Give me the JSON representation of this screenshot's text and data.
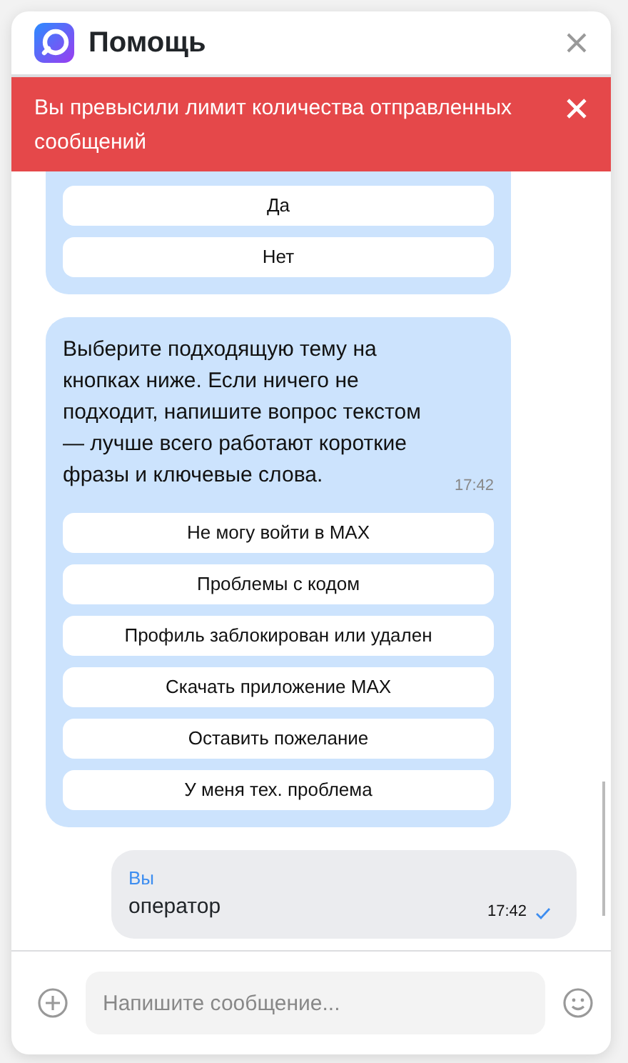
{
  "header": {
    "title": "Помощь"
  },
  "alert": {
    "text": "Вы превысили лимит количества отправленных сообщений"
  },
  "messages": [
    {
      "kind": "bot",
      "cut": true,
      "buttons": [
        "Да",
        "Нет"
      ]
    },
    {
      "kind": "bot",
      "cut": false,
      "text": "Выберите подходящую тему на кнопках ниже. Если ничего не подходит, напишите вопрос текстом — лучше всего работают короткие фразы и ключевые слова.",
      "time": "17:42",
      "buttons": [
        "Не могу войти в MAX",
        "Проблемы с кодом",
        "Профиль заблокирован или удален",
        "Скачать приложение MAX",
        "Оставить пожелание",
        "У меня тех. проблема"
      ]
    },
    {
      "kind": "user",
      "author": "Вы",
      "text": "оператор",
      "time": "17:42",
      "read": true
    }
  ],
  "composer": {
    "placeholder": "Напишите сообщение..."
  }
}
